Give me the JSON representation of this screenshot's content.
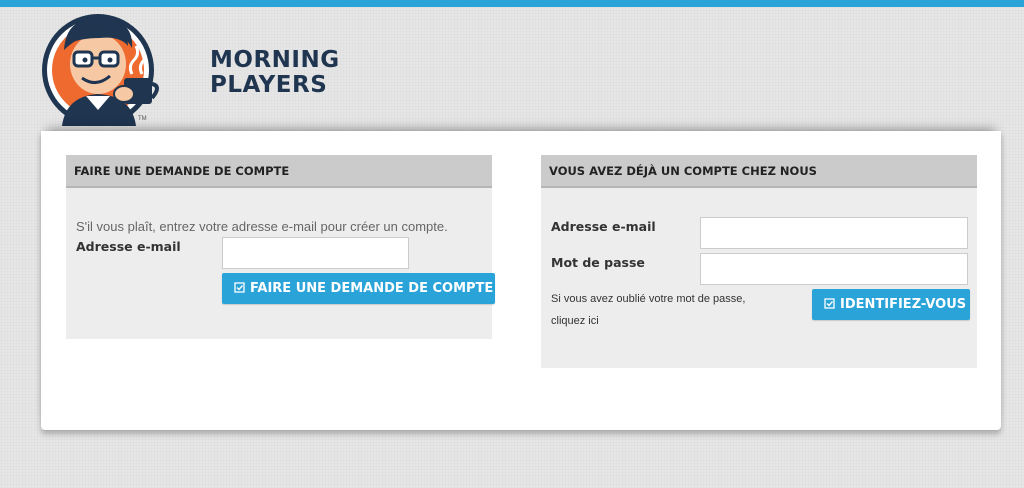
{
  "brand": {
    "line1": "MORNING",
    "line2": "PLAYERS",
    "trademark": "TM"
  },
  "request_panel": {
    "title": "FAIRE UNE DEMANDE DE COMPTE",
    "instructions": "S'il vous plaît, entrez votre adresse e-mail pour créer un compte.",
    "email_label": "Adresse e-mail",
    "email_value": "",
    "button_label": "FAIRE UNE DEMANDE DE COMPTE",
    "button_icon": "check-icon"
  },
  "login_panel": {
    "title": "VOUS AVEZ DÉJÀ UN COMPTE CHEZ NOUS",
    "email_label": "Adresse e-mail",
    "email_value": "",
    "password_label": "Mot de passe",
    "password_value": "",
    "forgot_text": "Si vous avez oublié votre mot de passe,",
    "forgot_link": "cliquez ici",
    "button_label": "IDENTIFIEZ-VOUS",
    "button_icon": "check-icon"
  },
  "colors": {
    "accent": "#2aa3d9",
    "brand_navy": "#1f3550",
    "logo_orange": "#ee6a2f"
  }
}
